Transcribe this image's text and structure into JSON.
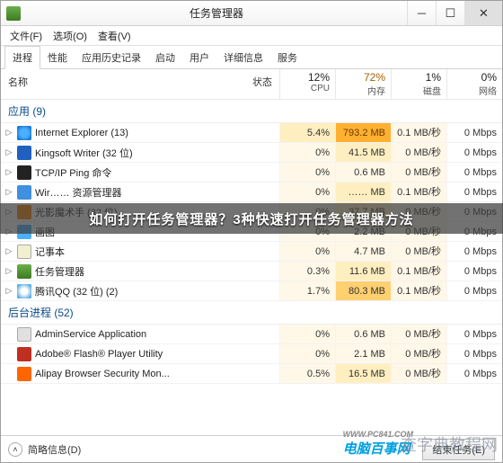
{
  "title": "任务管理器",
  "winbtns": {
    "min": "─",
    "max": "☐",
    "close": "✕"
  },
  "menu": {
    "file": "文件(F)",
    "options": "选项(O)",
    "view": "查看(V)"
  },
  "tabs": [
    "进程",
    "性能",
    "应用历史记录",
    "启动",
    "用户",
    "详细信息",
    "服务"
  ],
  "header": {
    "name": "名称",
    "status": "状态",
    "cols": [
      {
        "pct": "12%",
        "lbl": "CPU",
        "hi": false
      },
      {
        "pct": "72%",
        "lbl": "内存",
        "hi": true
      },
      {
        "pct": "1%",
        "lbl": "磁盘",
        "hi": false
      },
      {
        "pct": "0%",
        "lbl": "网络",
        "hi": false
      }
    ]
  },
  "groups": {
    "apps": "应用 (9)",
    "bg": "后台进程 (52)"
  },
  "rows": [
    {
      "g": "a",
      "tw": "▷",
      "ic": "ic-ie",
      "nm": "Internet Explorer (13)",
      "c": [
        {
          "v": "5.4%",
          "l": 2
        },
        {
          "v": "793.2 MB",
          "l": 4
        },
        {
          "v": "0.1 MB/秒",
          "l": 1
        },
        {
          "v": "0 Mbps",
          "l": 0
        }
      ]
    },
    {
      "g": "a",
      "tw": "▷",
      "ic": "ic-kw",
      "nm": "Kingsoft Writer (32 位)",
      "c": [
        {
          "v": "0%",
          "l": 1
        },
        {
          "v": "41.5 MB",
          "l": 2
        },
        {
          "v": "0 MB/秒",
          "l": 1
        },
        {
          "v": "0 Mbps",
          "l": 0
        }
      ]
    },
    {
      "g": "a",
      "tw": "▷",
      "ic": "ic-cmd",
      "nm": "TCP/IP Ping 命令",
      "c": [
        {
          "v": "0%",
          "l": 1
        },
        {
          "v": "0.6 MB",
          "l": 1
        },
        {
          "v": "0 MB/秒",
          "l": 1
        },
        {
          "v": "0 Mbps",
          "l": 0
        }
      ]
    },
    {
      "g": "a",
      "tw": "▷",
      "ic": "ic-wir",
      "nm": "Wir…… 资源管理器",
      "c": [
        {
          "v": "0%",
          "l": 1
        },
        {
          "v": "…… MB",
          "l": 2
        },
        {
          "v": "0.1 MB/秒",
          "l": 1
        },
        {
          "v": "0 Mbps",
          "l": 0
        }
      ]
    },
    {
      "g": "a",
      "tw": "▷",
      "ic": "ic-gy",
      "nm": "光影魔术手 (32 位)",
      "c": [
        {
          "v": "0%",
          "l": 1
        },
        {
          "v": "37.7 MB",
          "l": 2
        },
        {
          "v": "0 MB/秒",
          "l": 1
        },
        {
          "v": "0 Mbps",
          "l": 0
        }
      ]
    },
    {
      "g": "a",
      "tw": "▷",
      "ic": "ic-ht",
      "nm": "画图",
      "c": [
        {
          "v": "0%",
          "l": 1
        },
        {
          "v": "2.2 MB",
          "l": 1
        },
        {
          "v": "0 MB/秒",
          "l": 1
        },
        {
          "v": "0 Mbps",
          "l": 0
        }
      ]
    },
    {
      "g": "a",
      "tw": "▷",
      "ic": "ic-np",
      "nm": "记事本",
      "c": [
        {
          "v": "0%",
          "l": 1
        },
        {
          "v": "4.7 MB",
          "l": 1
        },
        {
          "v": "0 MB/秒",
          "l": 1
        },
        {
          "v": "0 Mbps",
          "l": 0
        }
      ]
    },
    {
      "g": "a",
      "tw": "▷",
      "ic": "ic-tm",
      "nm": "任务管理器",
      "c": [
        {
          "v": "0.3%",
          "l": 1
        },
        {
          "v": "11.6 MB",
          "l": 2
        },
        {
          "v": "0.1 MB/秒",
          "l": 1
        },
        {
          "v": "0 Mbps",
          "l": 0
        }
      ]
    },
    {
      "g": "a",
      "tw": "▷",
      "ic": "ic-qq",
      "nm": "腾讯QQ (32 位) (2)",
      "c": [
        {
          "v": "1.7%",
          "l": 1
        },
        {
          "v": "80.3 MB",
          "l": 3
        },
        {
          "v": "0.1 MB/秒",
          "l": 1
        },
        {
          "v": "0 Mbps",
          "l": 0
        }
      ]
    },
    {
      "g": "b",
      "tw": "",
      "ic": "ic-as",
      "nm": "AdminService Application",
      "c": [
        {
          "v": "0%",
          "l": 1
        },
        {
          "v": "0.6 MB",
          "l": 1
        },
        {
          "v": "0 MB/秒",
          "l": 1
        },
        {
          "v": "0 Mbps",
          "l": 0
        }
      ]
    },
    {
      "g": "b",
      "tw": "",
      "ic": "ic-fl",
      "nm": "Adobe® Flash® Player Utility",
      "c": [
        {
          "v": "0%",
          "l": 1
        },
        {
          "v": "2.1 MB",
          "l": 1
        },
        {
          "v": "0 MB/秒",
          "l": 1
        },
        {
          "v": "0 Mbps",
          "l": 0
        }
      ]
    },
    {
      "g": "b",
      "tw": "",
      "ic": "ic-ap",
      "nm": "Alipay Browser Security Mon...",
      "c": [
        {
          "v": "0.5%",
          "l": 1
        },
        {
          "v": "16.5 MB",
          "l": 2
        },
        {
          "v": "0 MB/秒",
          "l": 1
        },
        {
          "v": "0 Mbps",
          "l": 0
        }
      ]
    }
  ],
  "status": {
    "fewer": "简略信息(D)",
    "end": "结束任务(E)"
  },
  "overlay": "如何打开任务管理器？3种快速打开任务管理器方法",
  "wm1": {
    "big": "电脑百事网",
    "sm": "WWW.PC841.COM"
  },
  "wm2": "查字典教程网"
}
